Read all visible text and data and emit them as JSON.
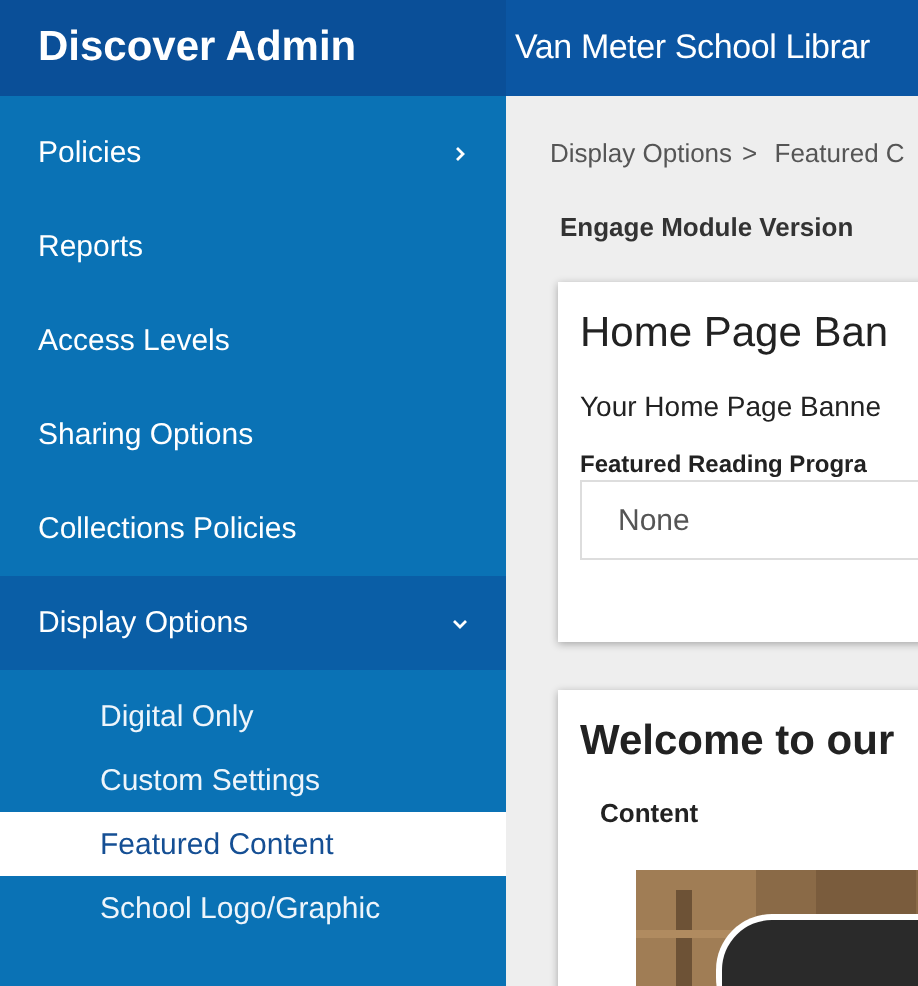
{
  "header": {
    "app_title": "Discover Admin",
    "library_name": "Van Meter School Librar"
  },
  "sidebar": {
    "items": [
      {
        "label": "Policies",
        "kind": "group",
        "expanded": false
      },
      {
        "label": "Reports",
        "kind": "link"
      },
      {
        "label": "Access Levels",
        "kind": "link"
      },
      {
        "label": "Sharing Options",
        "kind": "link"
      },
      {
        "label": "Collections Policies",
        "kind": "link"
      },
      {
        "label": "Display Options",
        "kind": "group",
        "expanded": true,
        "children": [
          {
            "label": "Digital Only",
            "selected": false
          },
          {
            "label": "Custom Settings",
            "selected": false
          },
          {
            "label": "Featured Content",
            "selected": true
          },
          {
            "label": "School Logo/Graphic",
            "selected": false
          }
        ]
      }
    ]
  },
  "breadcrumb": [
    "Display Options",
    "Featured C"
  ],
  "breadcrumb_separator": ">",
  "section_label": "Engage Module Version",
  "banner_card": {
    "title": "Home Page Ban",
    "description": "Your Home Page Banne",
    "field_label": "Featured Reading Progra",
    "select_value": "None"
  },
  "welcome_card": {
    "title": "Welcome to our",
    "content_label": "Content"
  }
}
